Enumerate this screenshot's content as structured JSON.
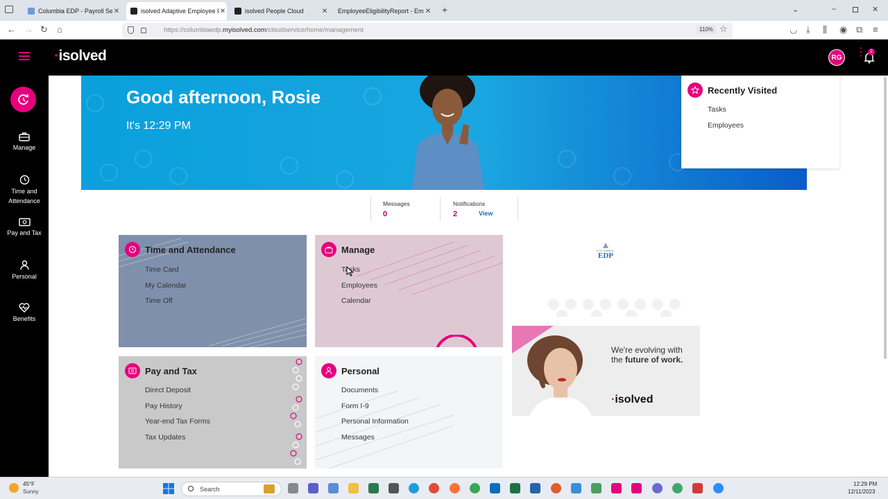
{
  "browser": {
    "tabs": [
      {
        "title": "Columbia EDP - Payroll Services",
        "active": false
      },
      {
        "title": "isolved Adaptive Employee Exp",
        "active": true
      },
      {
        "title": "isolved People Cloud",
        "active": false
      },
      {
        "title": "EmployeeEligibilityReport - Employ",
        "active": false
      }
    ],
    "url_prefix": "https://columbiaedp.",
    "url_domain": "myisolved.com",
    "url_path": "/cloudservice/home/management",
    "zoom": "110%"
  },
  "header": {
    "logo_text": "isolved",
    "avatar_initials": "RG",
    "notification_count": "2"
  },
  "sidebar": {
    "items": [
      {
        "label": "Manage",
        "icon": "briefcase-icon"
      },
      {
        "label": "Time and Attendance",
        "icon": "clock-icon"
      },
      {
        "label": "Pay and Tax",
        "icon": "money-icon"
      },
      {
        "label": "Personal",
        "icon": "person-icon"
      },
      {
        "label": "Benefits",
        "icon": "heart-pulse-icon"
      }
    ]
  },
  "banner": {
    "greeting": "Good afternoon, Rosie",
    "time_text": "It's 12:29 PM"
  },
  "recently_visited": {
    "title": "Recently Visited",
    "items": [
      "Tasks",
      "Employees"
    ]
  },
  "stats": {
    "messages_label": "Messages",
    "messages_value": "0",
    "notifications_label": "Notifications",
    "notifications_value": "2",
    "view_label": "View"
  },
  "cards": {
    "time_attendance": {
      "title": "Time and Attendance",
      "items": [
        "Time Card",
        "My Calendar",
        "Time Off"
      ]
    },
    "manage": {
      "title": "Manage",
      "items": [
        "Tasks",
        "Employees",
        "Calendar"
      ]
    },
    "pay_tax": {
      "title": "Pay and Tax",
      "items": [
        "Direct Deposit",
        "Pay History",
        "Year-end Tax Forms",
        "Tax Updates"
      ]
    },
    "personal": {
      "title": "Personal",
      "items": [
        "Documents",
        "Form I-9",
        "Personal Information",
        "Messages"
      ]
    }
  },
  "company_logo": {
    "line1": "COLUMBIA",
    "line2": "EDP"
  },
  "promo": {
    "line1": "We're evolving with",
    "line2_pre": "the ",
    "line2_bold": "future of work.",
    "brand": "isolved"
  },
  "taskbar": {
    "weather_temp": "45°F",
    "weather_desc": "Sunny",
    "search_placeholder": "Search",
    "time": "12:29 PM",
    "date": "12/11/2023"
  },
  "colors": {
    "accent": "#e6007e",
    "banner": "#0aa0dc"
  }
}
